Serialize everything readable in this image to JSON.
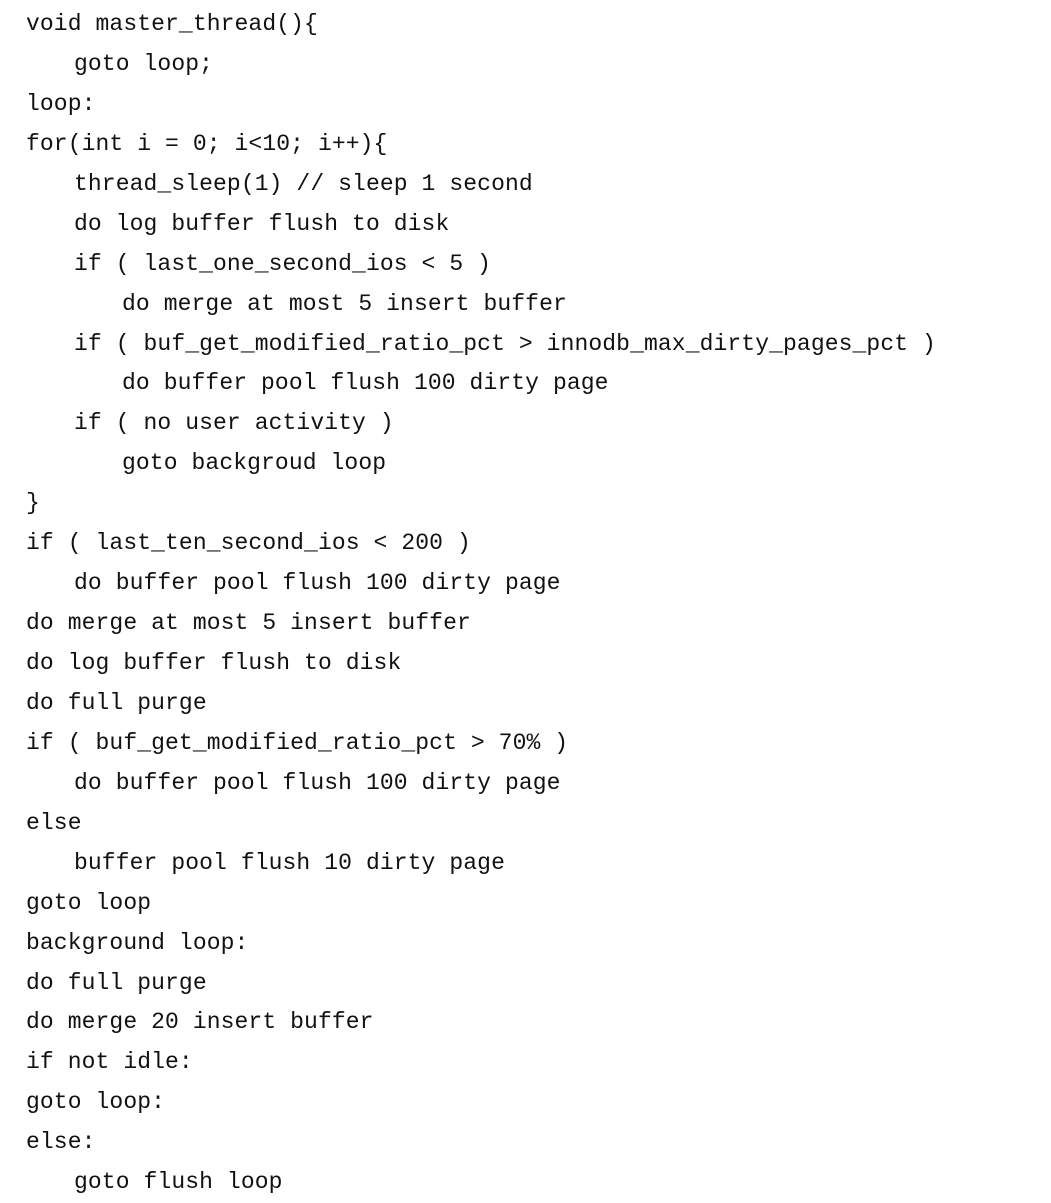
{
  "code": {
    "lines": [
      "void master_thread(){",
      "goto loop;",
      "loop:",
      "for(int i = 0; i<10; i++){",
      "thread_sleep(1) // sleep 1 second",
      "do log buffer flush to disk",
      "if ( last_one_second_ios < 5 )",
      "do merge at most 5 insert buffer",
      "if ( buf_get_modified_ratio_pct > innodb_max_dirty_pages_pct )",
      "do buffer pool flush 100 dirty page",
      "if ( no user activity )",
      "goto backgroud loop",
      "}",
      "if ( last_ten_second_ios < 200 )",
      "do buffer pool flush 100 dirty page",
      "do merge at most 5 insert buffer",
      "do log buffer flush to disk",
      "do full purge",
      "if ( buf_get_modified_ratio_pct > 70% )",
      "do buffer pool flush 100 dirty page",
      "else",
      "buffer pool flush 10 dirty page",
      "goto loop",
      "background loop:",
      "do full purge",
      "do merge 20 insert buffer",
      "if not idle:",
      "goto loop:",
      "else:",
      "goto flush loop"
    ]
  }
}
